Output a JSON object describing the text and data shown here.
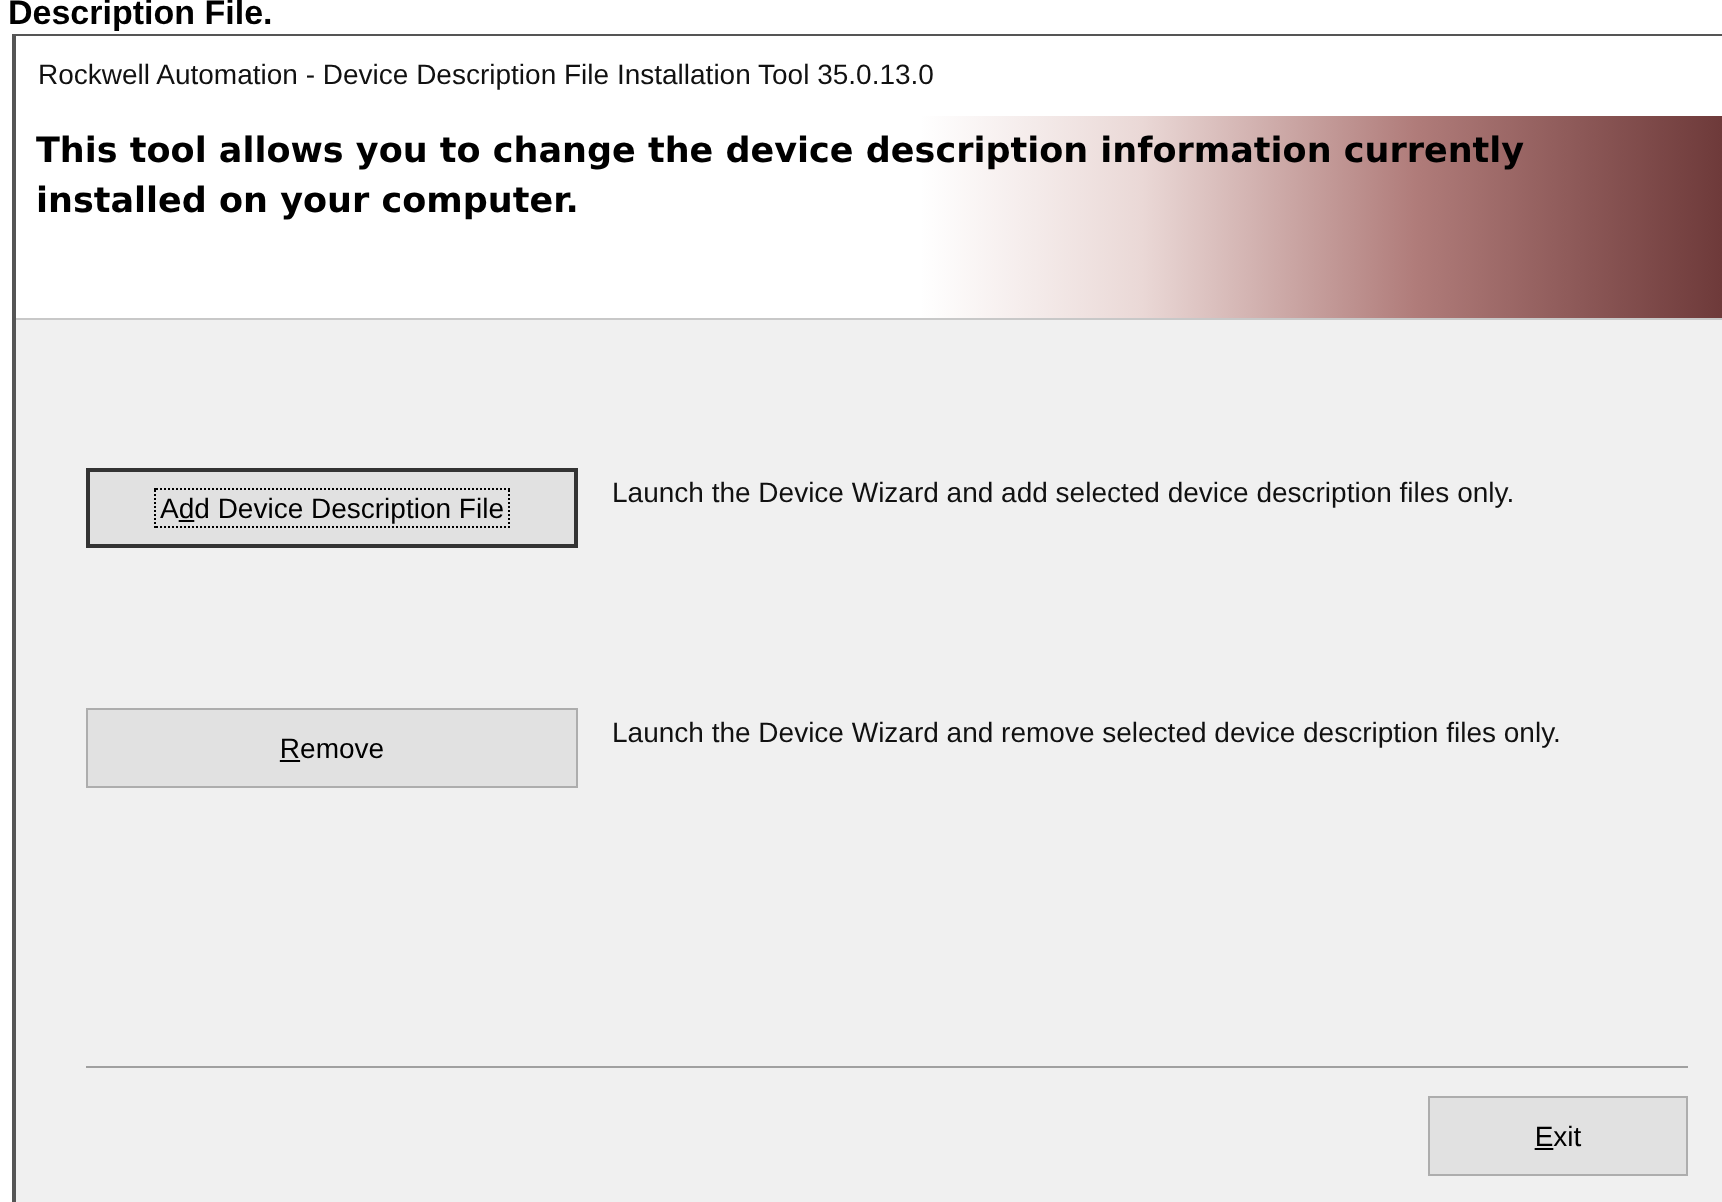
{
  "page_heading": "Description File.",
  "window": {
    "title": "Rockwell Automation - Device Description File Installation Tool  35.0.13.0"
  },
  "banner": {
    "text": "This tool allows you to change the device description information currently installed on your computer."
  },
  "actions": [
    {
      "label": {
        "before": "A",
        "key": "d",
        "after": "d Device Description File"
      },
      "focused": true,
      "description": "Launch the Device Wizard and add selected device description files only."
    },
    {
      "label": {
        "key": "R",
        "after": "emove"
      },
      "focused": false,
      "description": "Launch the Device Wizard and remove selected device description files only."
    }
  ],
  "footer_button": {
    "label": {
      "key": "E",
      "after": "xit"
    },
    "focused": false
  }
}
